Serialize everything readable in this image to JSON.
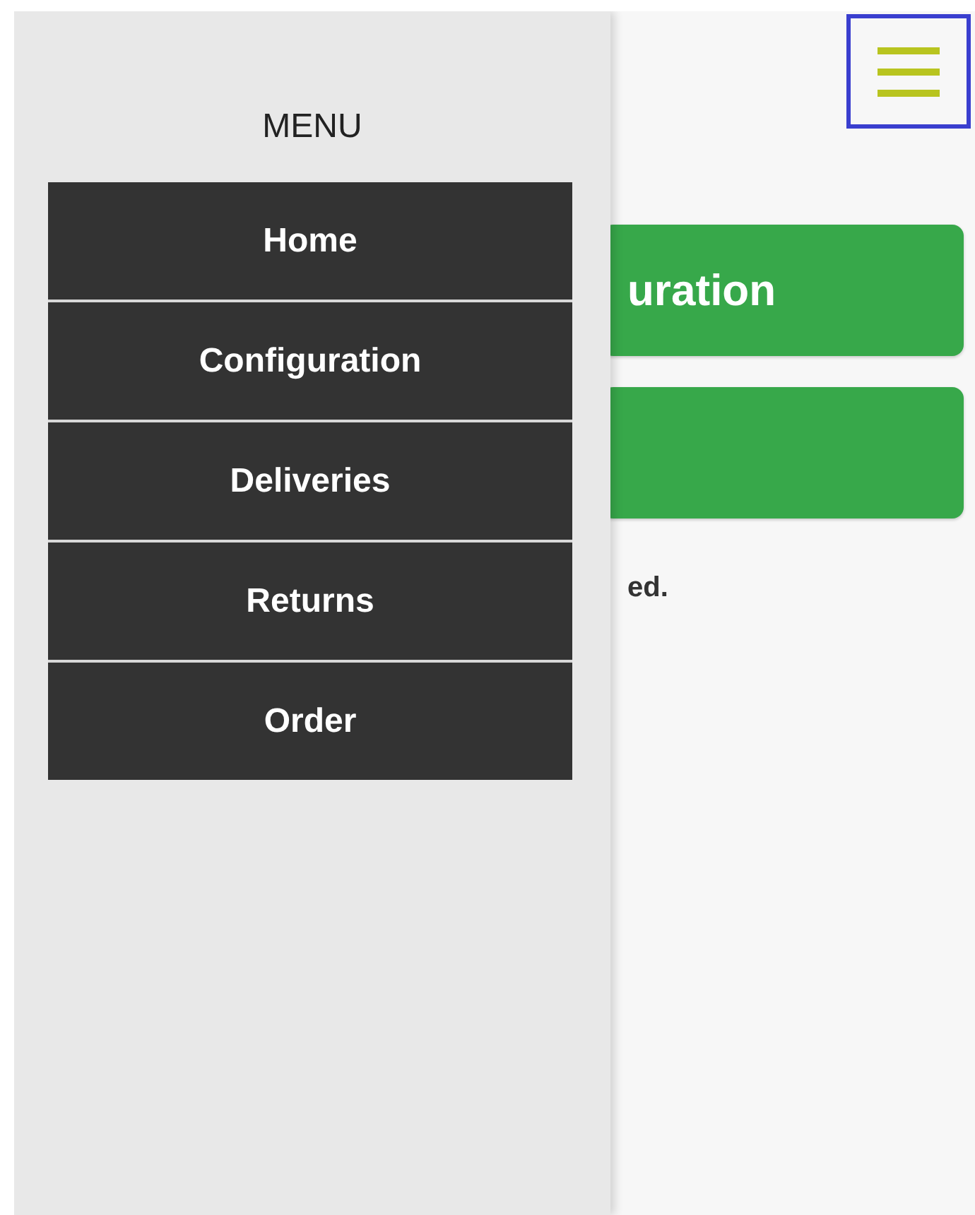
{
  "drawer": {
    "title": "MENU",
    "items": [
      {
        "label": "Home"
      },
      {
        "label": "Configuration"
      },
      {
        "label": "Deliveries"
      },
      {
        "label": "Returns"
      },
      {
        "label": "Order"
      }
    ]
  },
  "main": {
    "buttons": [
      {
        "kind": "labeled",
        "label": "uration"
      },
      {
        "kind": "blank"
      }
    ],
    "note": "ed."
  }
}
